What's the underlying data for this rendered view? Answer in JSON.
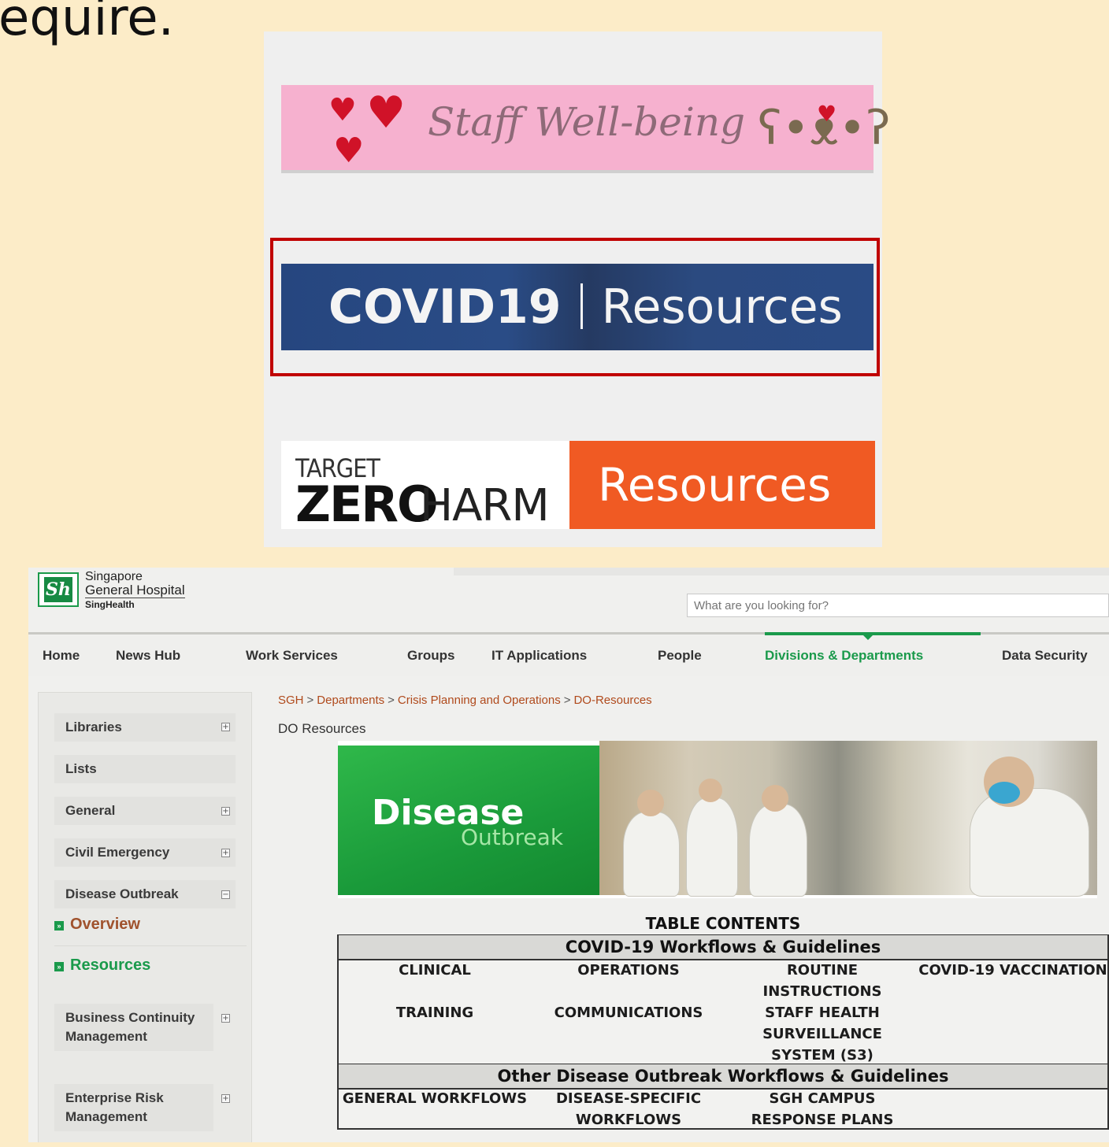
{
  "heading_fragment": "equire.",
  "banners": {
    "wellbeing": {
      "label": "Staff Well-being"
    },
    "covid": {
      "label_bold": "COVID19",
      "label_rest": "Resources"
    },
    "zero_harm": {
      "target": "TARGET",
      "zero": "ZERO",
      "harm": "HARM",
      "resources": "Resources"
    }
  },
  "intranet": {
    "logo": {
      "line1": "Singapore",
      "line2": "General Hospital",
      "line3": "SingHealth",
      "mark": "Sh"
    },
    "search": {
      "placeholder": "What are you looking for?"
    },
    "nav": [
      {
        "label": "Home",
        "active": false
      },
      {
        "label": "News Hub",
        "active": false
      },
      {
        "label": "Work Services",
        "active": false
      },
      {
        "label": "Groups",
        "active": false
      },
      {
        "label": "IT Applications",
        "active": false
      },
      {
        "label": "People",
        "active": false
      },
      {
        "label": "Divisions & Departments",
        "active": true
      },
      {
        "label": "Data Security",
        "active": false
      }
    ],
    "sidebar": {
      "items": [
        {
          "label": "Libraries",
          "expander": "+"
        },
        {
          "label": "Lists"
        },
        {
          "label": "General",
          "expander": "+"
        },
        {
          "label": "Civil Emergency",
          "expander": "+"
        },
        {
          "label": "Disease Outbreak",
          "expander": "−"
        },
        {
          "label": "Business Continuity Management",
          "expander": "+"
        },
        {
          "label": "Enterprise Risk Management",
          "expander": "+"
        }
      ],
      "sub_links": [
        {
          "label": "Overview",
          "bullet": "»"
        },
        {
          "label": "Resources",
          "bullet": "»"
        }
      ]
    },
    "breadcrumb": [
      "SGH",
      "Departments",
      "Crisis Planning and Operations",
      "DO-Resources"
    ],
    "breadcrumb_separator": ">",
    "page_title": "DO Resources",
    "do_banner": {
      "title": "Disease",
      "subtitle": "Outbreak"
    },
    "toc": {
      "title": "TABLE CONTENTS",
      "section1": {
        "heading": "COVID-19 Workflows & Guidelines",
        "links": [
          "CLINICAL",
          "OPERATIONS",
          "ROUTINE INSTRUCTIONS",
          "COVID-19 VACCINATION",
          "TRAINING",
          "COMMUNICATIONS",
          "STAFF HEALTH SURVEILLANCE SYSTEM (S3)"
        ]
      },
      "section2": {
        "heading": "Other Disease Outbreak Workflows & Guidelines",
        "links": [
          "GENERAL WORKFLOWS",
          "DISEASE-SPECIFIC WORKFLOWS",
          "SGH CAMPUS RESPONSE PLANS"
        ]
      }
    }
  },
  "colors": {
    "page_bg": "#fcecc8",
    "highlight_frame": "#c00000",
    "sgh_green": "#1a9a4b",
    "breadcrumb": "#b04a1c",
    "zero_harm_orange": "#f05a23",
    "covid_blue": "#2a4b85"
  }
}
